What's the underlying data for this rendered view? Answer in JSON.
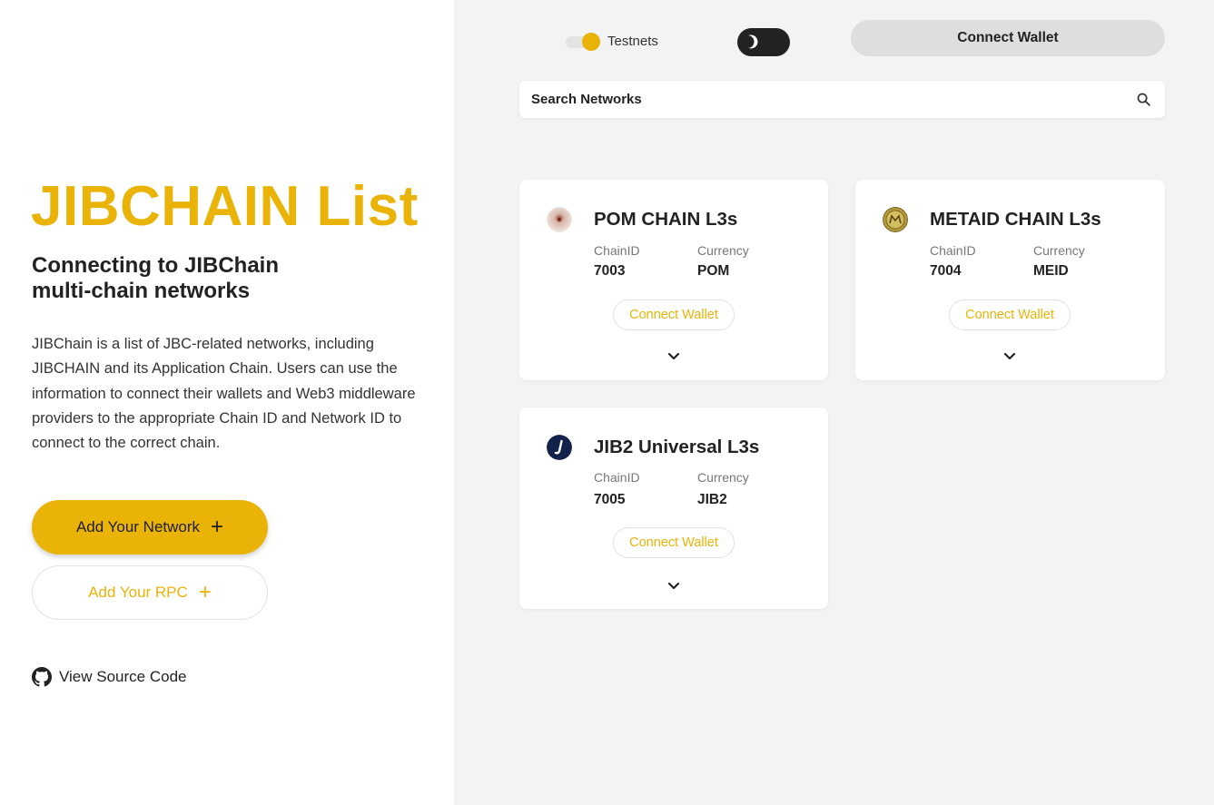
{
  "hero": {
    "title": "JIBCHAIN List",
    "subtitle": "Connecting to JIBChain multi-chain networks",
    "description": "JIBChain is a list of JBC-related networks, including JIBCHAIN and its Application Chain. Users can use the information to connect their wallets and Web3 middleware providers to the appropriate Chain ID and Network ID to connect to the correct chain.",
    "add_network_label": "Add Your Network",
    "add_rpc_label": "Add Your RPC",
    "source_link": "View Source Code"
  },
  "topbar": {
    "testnets_label": "Testnets",
    "testnets_enabled": true,
    "connect_wallet_label": "Connect Wallet"
  },
  "search": {
    "placeholder": "Search Networks"
  },
  "colors": {
    "accent": "#eab308",
    "panel_bg": "#f3f3f3"
  },
  "networks": [
    {
      "name": "POM CHAIN L3s",
      "chainid_label": "ChainID",
      "chainid": "7003",
      "currency_label": "Currency",
      "currency": "POM",
      "connect_label": "Connect Wallet"
    },
    {
      "name": "METAID CHAIN L3s",
      "chainid_label": "ChainID",
      "chainid": "7004",
      "currency_label": "Currency",
      "currency": "MEID",
      "connect_label": "Connect Wallet"
    },
    {
      "name": "JIB2 Universal L3s",
      "chainid_label": "ChainID",
      "chainid": "7005",
      "currency_label": "Currency",
      "currency": "JIB2",
      "connect_label": "Connect Wallet"
    }
  ]
}
